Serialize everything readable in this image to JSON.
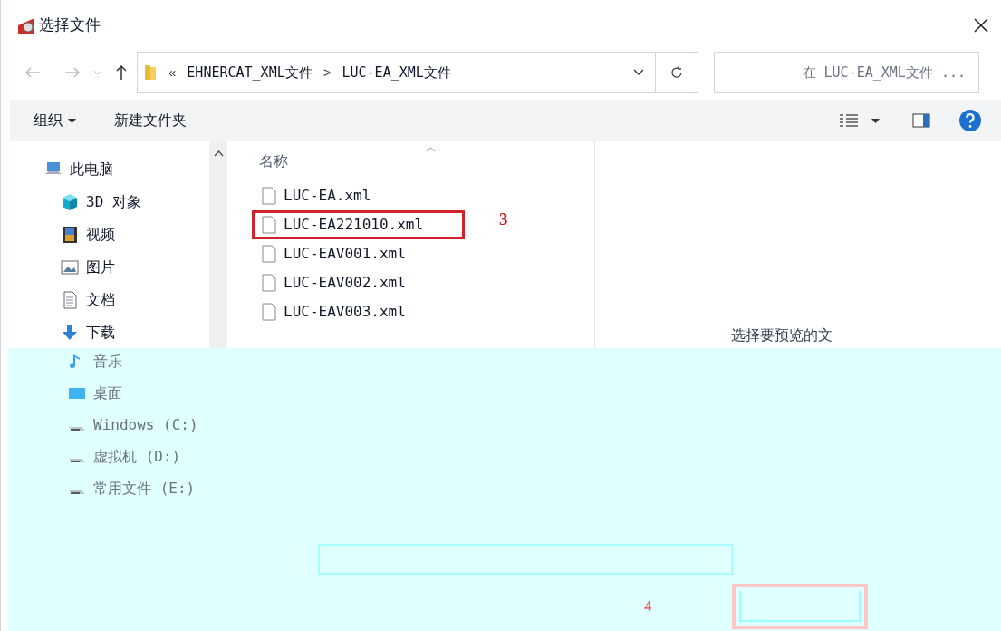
{
  "window": {
    "title": "选择文件"
  },
  "address": {
    "overflow": "«",
    "path": [
      "EHNERCAT_XML文件",
      "LUC-EA_XML文件"
    ],
    "separator": ">"
  },
  "search": {
    "placeholder": "在 LUC-EA_XML文件 ..."
  },
  "toolbar": {
    "organize": "组织",
    "new_folder": "新建文件夹"
  },
  "sidebar": {
    "items": [
      {
        "label": "此电脑",
        "kind": "pc"
      },
      {
        "label": "3D 对象",
        "kind": "cube"
      },
      {
        "label": "视频",
        "kind": "film"
      },
      {
        "label": "图片",
        "kind": "image"
      },
      {
        "label": "文档",
        "kind": "doc"
      },
      {
        "label": "下载",
        "kind": "download"
      }
    ]
  },
  "file_list": {
    "column": "名称",
    "callout": "3",
    "files": [
      {
        "name": "LUC-EA.xml",
        "highlighted": false
      },
      {
        "name": "LUC-EA221010.xml",
        "highlighted": true
      },
      {
        "name": "LUC-EAV001.xml",
        "highlighted": false
      },
      {
        "name": "LUC-EAV002.xml",
        "highlighted": false
      },
      {
        "name": "LUC-EAV003.xml",
        "highlighted": false
      }
    ]
  },
  "preview": {
    "message": "选择要预览的文"
  },
  "damaged_area": {
    "sidebar_items": [
      {
        "label": "音乐",
        "kind": "music"
      },
      {
        "label": "桌面",
        "kind": "desktop"
      },
      {
        "label": "Windows (C:)",
        "kind": "drive"
      },
      {
        "label": "虚拟机 (D:)",
        "kind": "drive"
      },
      {
        "label": "常用文件 (E:)",
        "kind": "drive"
      }
    ],
    "callout": "4"
  }
}
